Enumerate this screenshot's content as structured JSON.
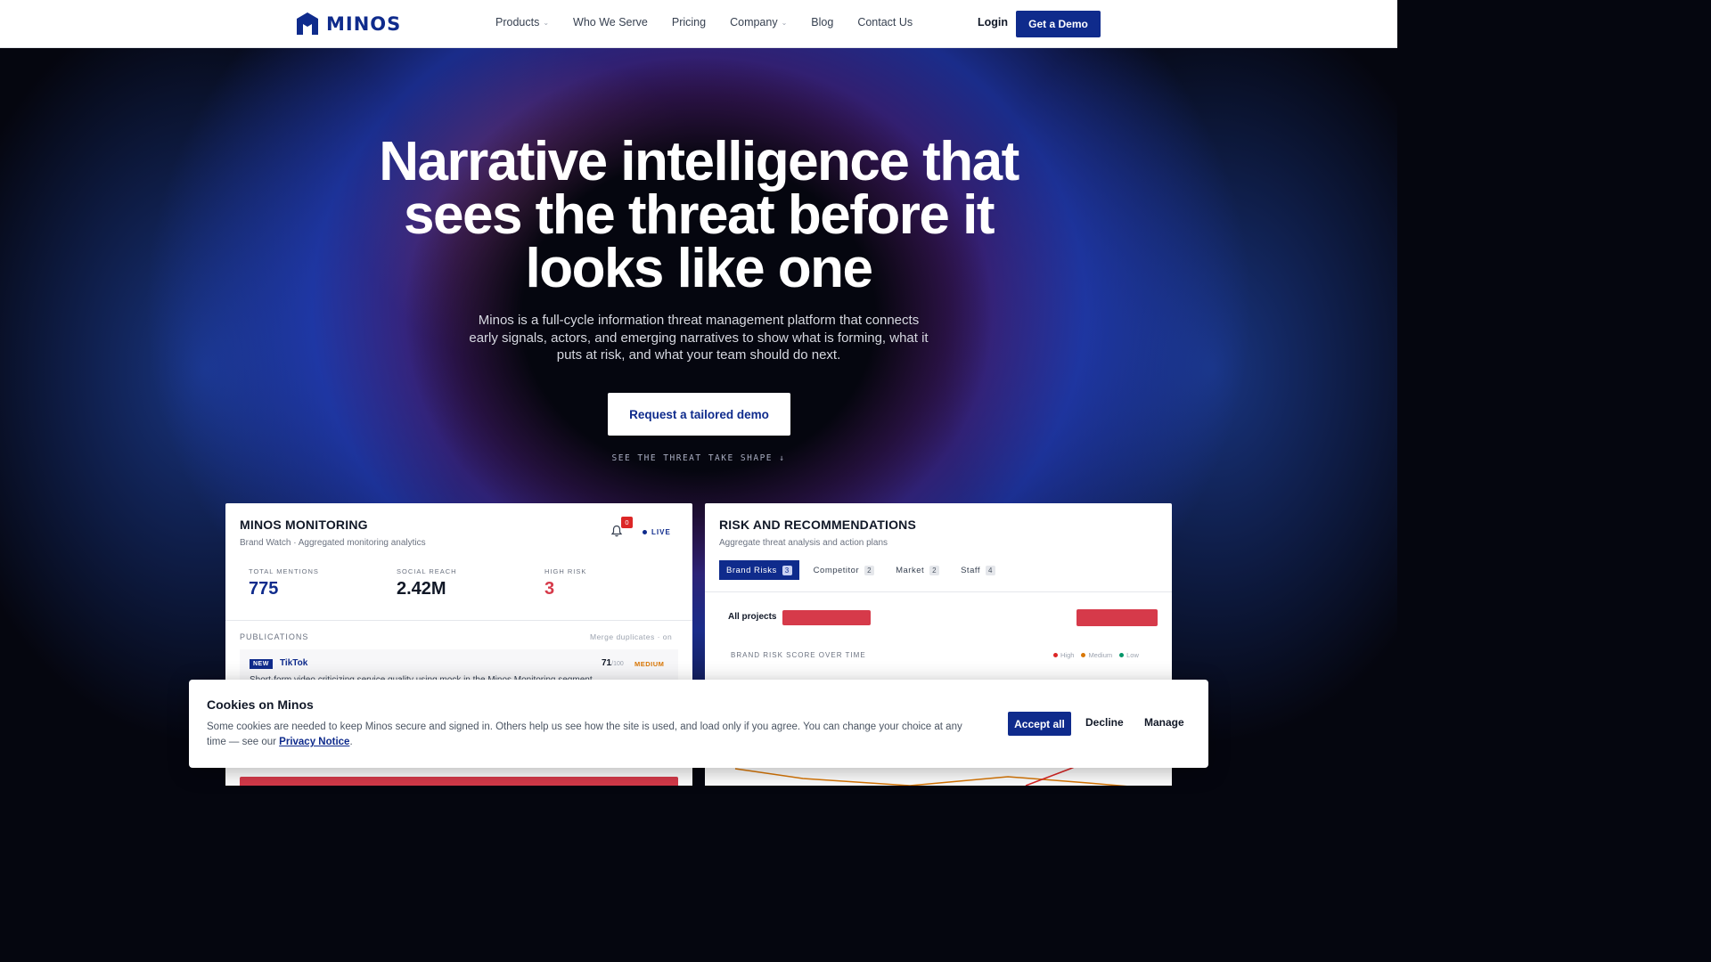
{
  "nav": {
    "logo_text": "MINOS",
    "links": [
      {
        "label": "Products",
        "has_dropdown": true
      },
      {
        "label": "Who We Serve",
        "has_dropdown": false
      },
      {
        "label": "Pricing",
        "has_dropdown": false
      },
      {
        "label": "Company",
        "has_dropdown": true
      },
      {
        "label": "Blog",
        "has_dropdown": false
      },
      {
        "label": "Contact Us",
        "has_dropdown": false
      }
    ],
    "login_label": "Login",
    "demo_label": "Get a Demo"
  },
  "hero": {
    "headline": "Narrative intelligence that sees the threat before it looks like one",
    "subhead": "Minos is a full-cycle information threat management platform that connects early signals, actors, and emerging narratives to show what is forming, what it puts at risk, and what your team should do next.",
    "cta_label": "Request a tailored demo",
    "scroll_hint": "SEE THE THREAT TAKE SHAPE ↓"
  },
  "monitoring": {
    "title": "MINOS MONITORING",
    "subtitle": "Brand Watch · Aggregated monitoring analytics",
    "notification_count": "0",
    "live_label": "LIVE",
    "stats": [
      {
        "label": "TOTAL MENTIONS",
        "value": "775",
        "color": "#0f2b8c"
      },
      {
        "label": "SOCIAL REACH",
        "value": "2.42M",
        "color": "#111827"
      },
      {
        "label": "HIGH RISK",
        "value": "3",
        "color": "#d63a4a"
      }
    ],
    "publications_label": "PUBLICATIONS",
    "merge_label": "Merge duplicates · on",
    "publication": {
      "badge": "NEW",
      "source": "TikTok",
      "score": "71",
      "score_max": "/100",
      "level": "MEDIUM",
      "snippet": "Short-form video criticizing service quality using mock in the Minos Monitoring segment"
    }
  },
  "risk": {
    "title": "RISK AND RECOMMENDATIONS",
    "subtitle": "Aggregate threat analysis and action plans",
    "tabs": [
      {
        "label": "Brand Risks",
        "count": "3",
        "active": true
      },
      {
        "label": "Competitor",
        "count": "2",
        "active": false
      },
      {
        "label": "Market",
        "count": "2",
        "active": false
      },
      {
        "label": "Staff",
        "count": "4",
        "active": false
      }
    ],
    "projects_label": "All projects",
    "chart_label": "BRAND RISK SCORE OVER TIME",
    "legend": [
      {
        "label": "High",
        "color": "#dc2626"
      },
      {
        "label": "Medium",
        "color": "#d97706"
      },
      {
        "label": "Low",
        "color": "#059669"
      }
    ]
  },
  "cookie": {
    "title": "Cookies on Minos",
    "text_before": "Some cookies are needed to keep Minos secure and signed in. Others help us see how the site is used, and load only if you agree. You can change your choice at any time — see our ",
    "link_label": "Privacy Notice",
    "text_after": ".",
    "accept_label": "Accept all",
    "decline_label": "Decline",
    "manage_label": "Manage"
  },
  "colors": {
    "brand": "#0f2b8c",
    "risk_red": "#d63a4a",
    "medium_orange": "#d97706"
  }
}
